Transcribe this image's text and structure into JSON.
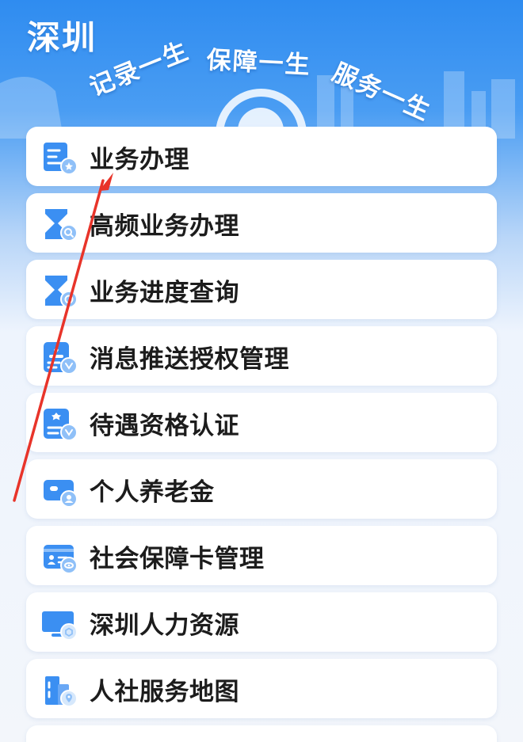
{
  "banner": {
    "city_title": "深圳",
    "slogans": [
      "记录一生",
      "保障一生",
      "服务一生"
    ]
  },
  "menu": {
    "items": [
      {
        "label": "业务办理",
        "icon": "business-handling-icon"
      },
      {
        "label": "高频业务办理",
        "icon": "hourglass-search-icon"
      },
      {
        "label": "业务进度查询",
        "icon": "hourglass-progress-icon"
      },
      {
        "label": "消息推送授权管理",
        "icon": "badge-authorization-icon"
      },
      {
        "label": "待遇资格认证",
        "icon": "badge-certification-icon"
      },
      {
        "label": "个人养老金",
        "icon": "wallet-pension-icon"
      },
      {
        "label": "社会保障卡管理",
        "icon": "id-card-icon"
      },
      {
        "label": "深圳人力资源",
        "icon": "monitor-icon"
      },
      {
        "label": "人社服务地图",
        "icon": "building-map-icon"
      }
    ]
  },
  "colors": {
    "banner_blue": "#2f8cf0",
    "icon_blue": "#3b8ff2",
    "arrow_red": "#e8342a"
  }
}
